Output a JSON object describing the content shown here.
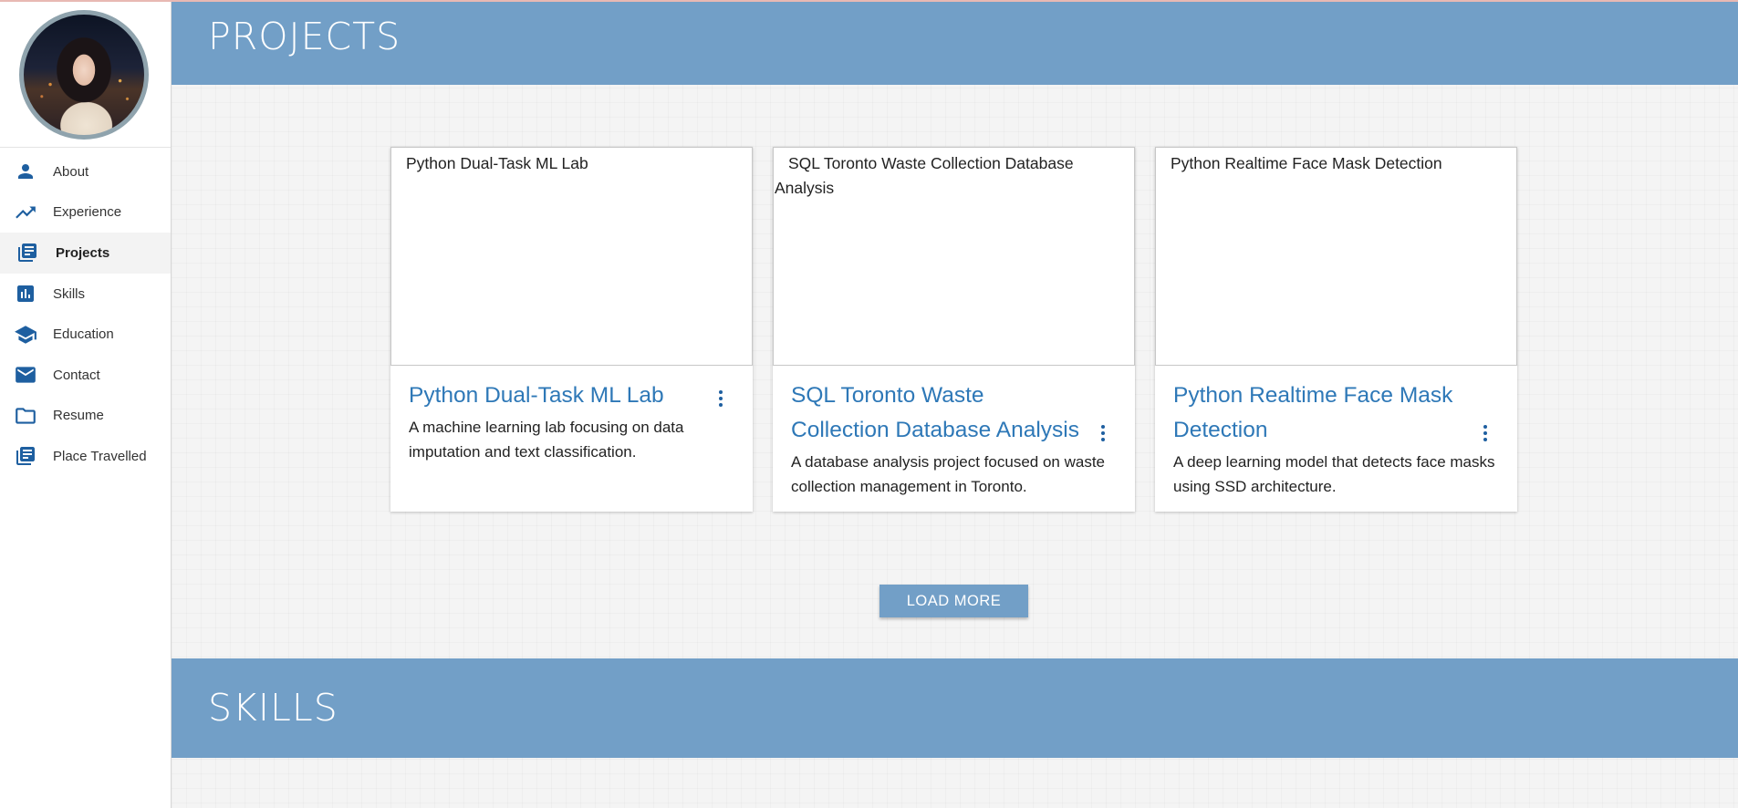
{
  "sidebar": {
    "items": [
      {
        "label": "About",
        "icon": "person-icon"
      },
      {
        "label": "Experience",
        "icon": "trending-up-icon"
      },
      {
        "label": "Projects",
        "icon": "library-books-icon"
      },
      {
        "label": "Skills",
        "icon": "bar-chart-icon"
      },
      {
        "label": "Education",
        "icon": "school-icon"
      },
      {
        "label": "Contact",
        "icon": "mail-icon"
      },
      {
        "label": "Resume",
        "icon": "folder-icon"
      },
      {
        "label": "Place Travelled",
        "icon": "library-books-icon"
      }
    ],
    "active": "Projects"
  },
  "projects": {
    "heading": "PROJECTS",
    "cards": [
      {
        "image_alt": "Python Dual-Task ML Lab",
        "title": "Python Dual-Task ML Lab",
        "description": "A machine learning lab focusing on data imputation and text classification."
      },
      {
        "image_alt": "SQL Toronto Waste Collection Database Analysis",
        "title": "SQL Toronto Waste Collection Database Analysis",
        "description": "A database analysis project focused on waste collection management in Toronto."
      },
      {
        "image_alt": "Python Realtime Face Mask Detection",
        "title": "Python Realtime Face Mask Detection",
        "description": "A deep learning model that detects face masks using SSD architecture."
      }
    ],
    "load_more_label": "LOAD MORE"
  },
  "skills": {
    "heading": "SKILLS"
  },
  "colors": {
    "banner": "#729fc7",
    "accent": "#1e5fa0",
    "card_title": "#2e78b7"
  }
}
